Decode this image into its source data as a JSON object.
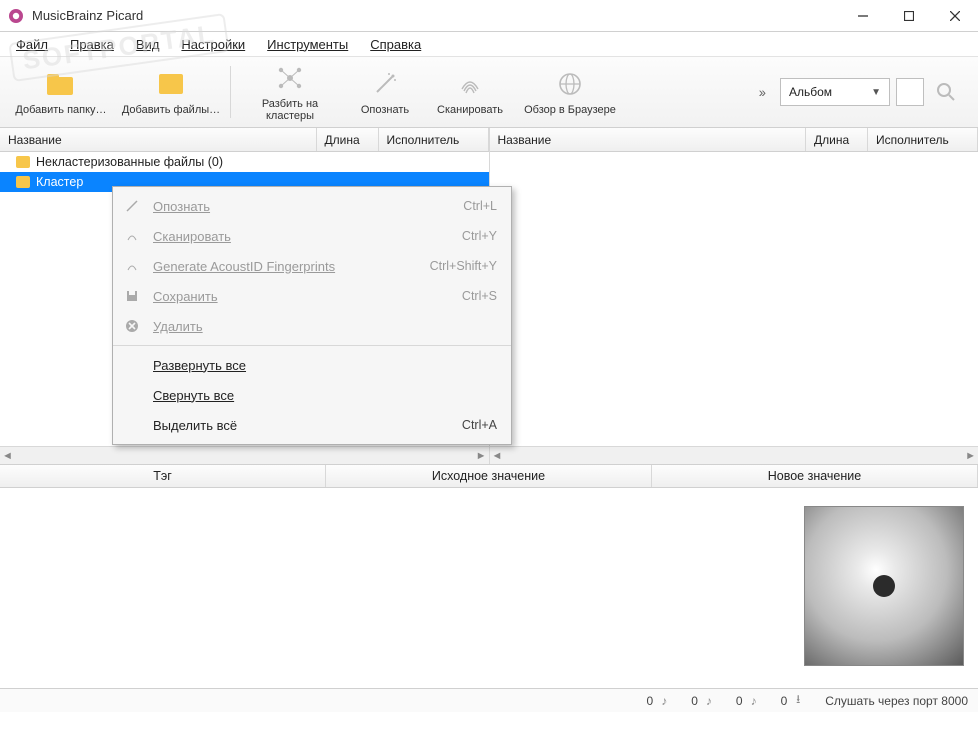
{
  "window": {
    "title": "MusicBrainz Picard"
  },
  "menu": {
    "file": "Файл",
    "edit": "Правка",
    "view": "Вид",
    "settings": "Настройки",
    "tools": "Инструменты",
    "help": "Справка"
  },
  "toolbar": {
    "add_folder": "Добавить папку…",
    "add_files": "Добавить файлы…",
    "cluster": "Разбить на кластеры",
    "lookup": "Опознать",
    "scan": "Сканировать",
    "browser": "Обзор в Браузере",
    "combo_label": "Альбом"
  },
  "columns": {
    "name": "Название",
    "length": "Длина",
    "artist": "Исполнитель"
  },
  "tree": {
    "unclustered": "Некластеризованные файлы (0)",
    "clusters": "Кластер"
  },
  "context_menu": {
    "lookup": "Опознать",
    "lookup_key": "Ctrl+L",
    "scan": "Сканировать",
    "scan_key": "Ctrl+Y",
    "acoustid": "Generate AcoustID Fingerprints",
    "acoustid_key": "Ctrl+Shift+Y",
    "save": "Сохранить",
    "save_key": "Ctrl+S",
    "remove": "Удалить",
    "expand": "Развернуть все",
    "collapse": "Свернуть все",
    "select_all": "Выделить всё",
    "select_all_key": "Ctrl+A"
  },
  "tag_panel": {
    "tag": "Тэг",
    "original": "Исходное значение",
    "new": "Новое значение"
  },
  "status": {
    "c1": "0",
    "c2": "0",
    "c3": "0",
    "c4": "0",
    "listen": "Слушать через порт 8000"
  },
  "watermark": "SOFTPORTAL"
}
